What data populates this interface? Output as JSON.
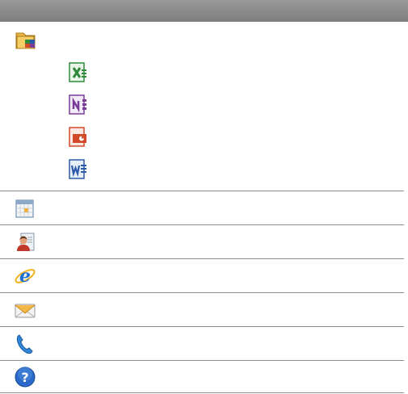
{
  "header": {
    "title": ""
  },
  "office_group": {
    "icon": "office-folder-icon",
    "apps": [
      {
        "icon": "excel-icon",
        "color": "#2e8b3a"
      },
      {
        "icon": "onenote-icon",
        "color": "#7b3c97"
      },
      {
        "icon": "powerpoint-icon",
        "color": "#d2492a"
      },
      {
        "icon": "word-icon",
        "color": "#2b5aa8"
      }
    ]
  },
  "items": [
    {
      "icon": "calendar-icon"
    },
    {
      "icon": "contacts-icon"
    },
    {
      "icon": "internet-explorer-icon"
    },
    {
      "icon": "messaging-icon"
    },
    {
      "icon": "phone-icon"
    },
    {
      "icon": "help-icon"
    }
  ]
}
